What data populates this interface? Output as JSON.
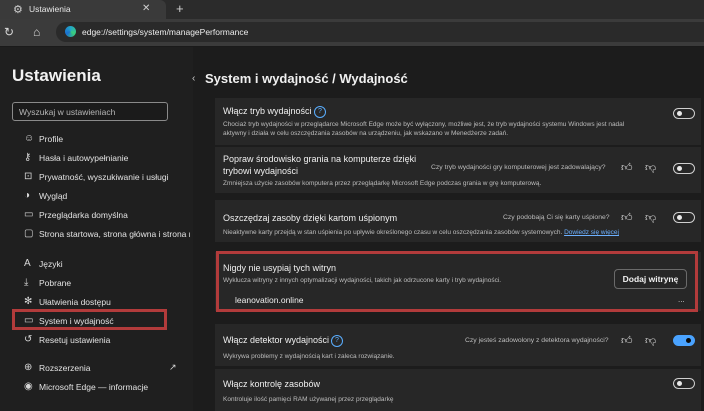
{
  "tab": {
    "title": "Ustawienia"
  },
  "address": {
    "url": "edge://settings/system/managePerformance"
  },
  "sidebar": {
    "title": "Ustawienia",
    "search_placeholder": "Wyszukaj w ustawieniach",
    "items": [
      {
        "label": "Profile",
        "icon": "profile-icon"
      },
      {
        "label": "Hasła i autowypełnianie",
        "icon": "key-icon"
      },
      {
        "label": "Prywatność, wyszukiwanie i usługi",
        "icon": "lock-icon"
      },
      {
        "label": "Wygląd",
        "icon": "appearance-icon"
      },
      {
        "label": "Przeglądarka domyślna",
        "icon": "browser-icon"
      },
      {
        "label": "Strona startowa, strona główna i strona nowej karty",
        "icon": "home-icon"
      },
      {
        "label": "Języki",
        "icon": "language-icon"
      },
      {
        "label": "Pobrane",
        "icon": "download-icon"
      },
      {
        "label": "Ułatwienia dostępu",
        "icon": "accessibility-icon"
      },
      {
        "label": "System i wydajność",
        "icon": "system-icon",
        "active": true
      },
      {
        "label": "Resetuj ustawienia",
        "icon": "reset-icon"
      },
      {
        "label": "Rozszerzenia",
        "icon": "extensions-icon"
      },
      {
        "label": "Microsoft Edge — informacje",
        "icon": "edge-icon"
      }
    ]
  },
  "main": {
    "page_title": "System i wydajność / Wydajność",
    "efficiency": {
      "title": "Włącz tryb wydajności",
      "desc1": "Chociaż tryb wydajności w przeglądarce Microsoft Edge może być wyłączony, możliwe jest, że tryb wydajności systemu Windows jest nadal",
      "desc2": "aktywny i działa w celu oszczędzania zasobów na urządzeniu, jak wskazano w Menedżerze zadań.",
      "toggle": "off"
    },
    "gaming": {
      "title1": "Popraw środowisko grania na komputerze dzięki",
      "title2": "trybowi wydajności",
      "desc": "Zmniejsza użycie zasobów komputera przez przeglądarkę Microsoft Edge podczas grania w grę komputerową.",
      "feedback": "Czy tryb wydajności gry komputerowej jest zadowalający?",
      "toggle": "off"
    },
    "sleeping": {
      "title": "Oszczędzaj zasoby dzięki kartom uśpionym",
      "desc": "Nieaktywne karty przejdą w stan uśpienia po upływie określonego czasu w celu oszczędzania zasobów systemowych.",
      "link": "Dowiedz się więcej",
      "feedback": "Czy podobają Ci się karty uśpione?",
      "toggle": "off"
    },
    "never_sleep": {
      "title": "Nigdy nie usypiaj tych witryn",
      "desc": "Wyklucza witryny z innych optymalizacji wydajności, takich jak odrzucone karty i tryb wydajności.",
      "button": "Dodaj witrynę",
      "site": "leanovation.online",
      "more": "..."
    },
    "detector": {
      "title": "Włącz detektor wydajności",
      "desc": "Wykrywa problemy z wydajnością kart i zaleca rozwiązanie.",
      "feedback": "Czy jesteś zadowolony z detektora wydajności?",
      "toggle": "on"
    },
    "resource": {
      "title": "Włącz kontrolę zasobów",
      "desc": "Kontroluje ilość pamięci RAM używanej przez przeglądarkę",
      "toggle": "off"
    }
  },
  "colors": {
    "accent": "#4aa3ff",
    "highlight": "#b23b3b"
  }
}
